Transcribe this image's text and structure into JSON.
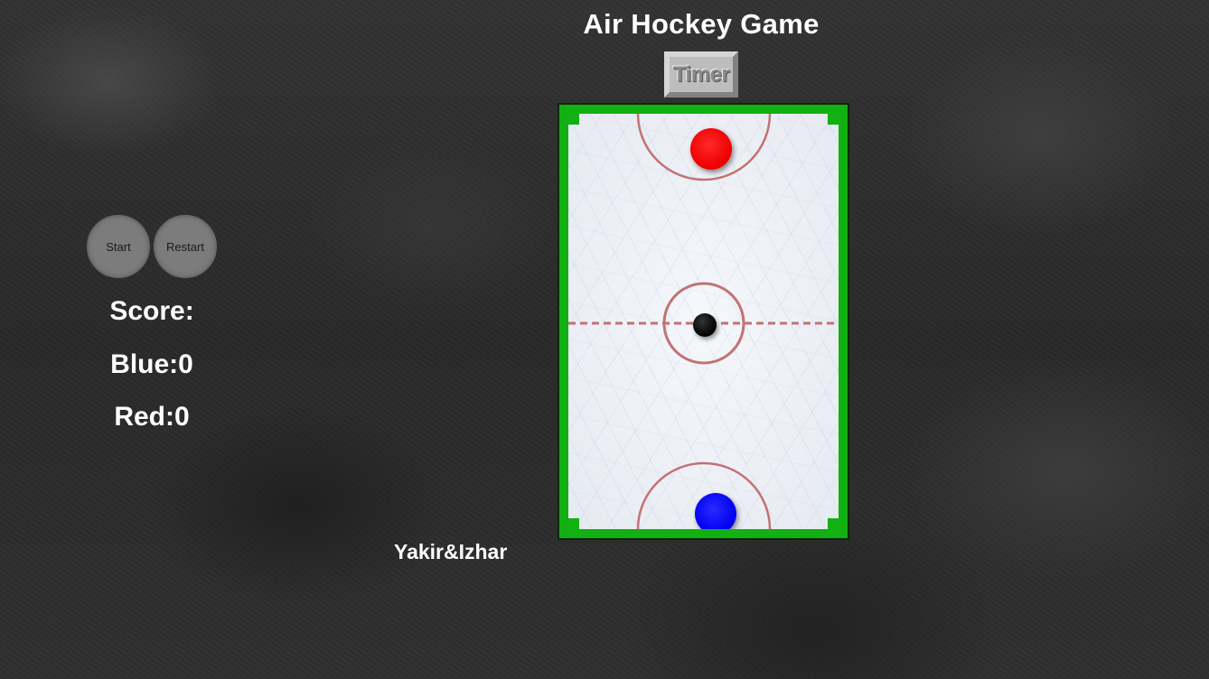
{
  "game": {
    "title": "Air Hockey Game",
    "timer_label": "Timer",
    "credits": "Yakir&Izhar"
  },
  "controls": {
    "start_label": "Start",
    "restart_label": "Restart"
  },
  "score": {
    "heading": "Score:",
    "blue_text": "Blue:0",
    "red_text": "Red:0",
    "blue": 0,
    "red": 0
  },
  "colors": {
    "board_border": "#12b012",
    "rink_markings": "#c27274",
    "red_mallet": "#f00000",
    "blue_mallet": "#0000f2",
    "puck": "#000000"
  }
}
